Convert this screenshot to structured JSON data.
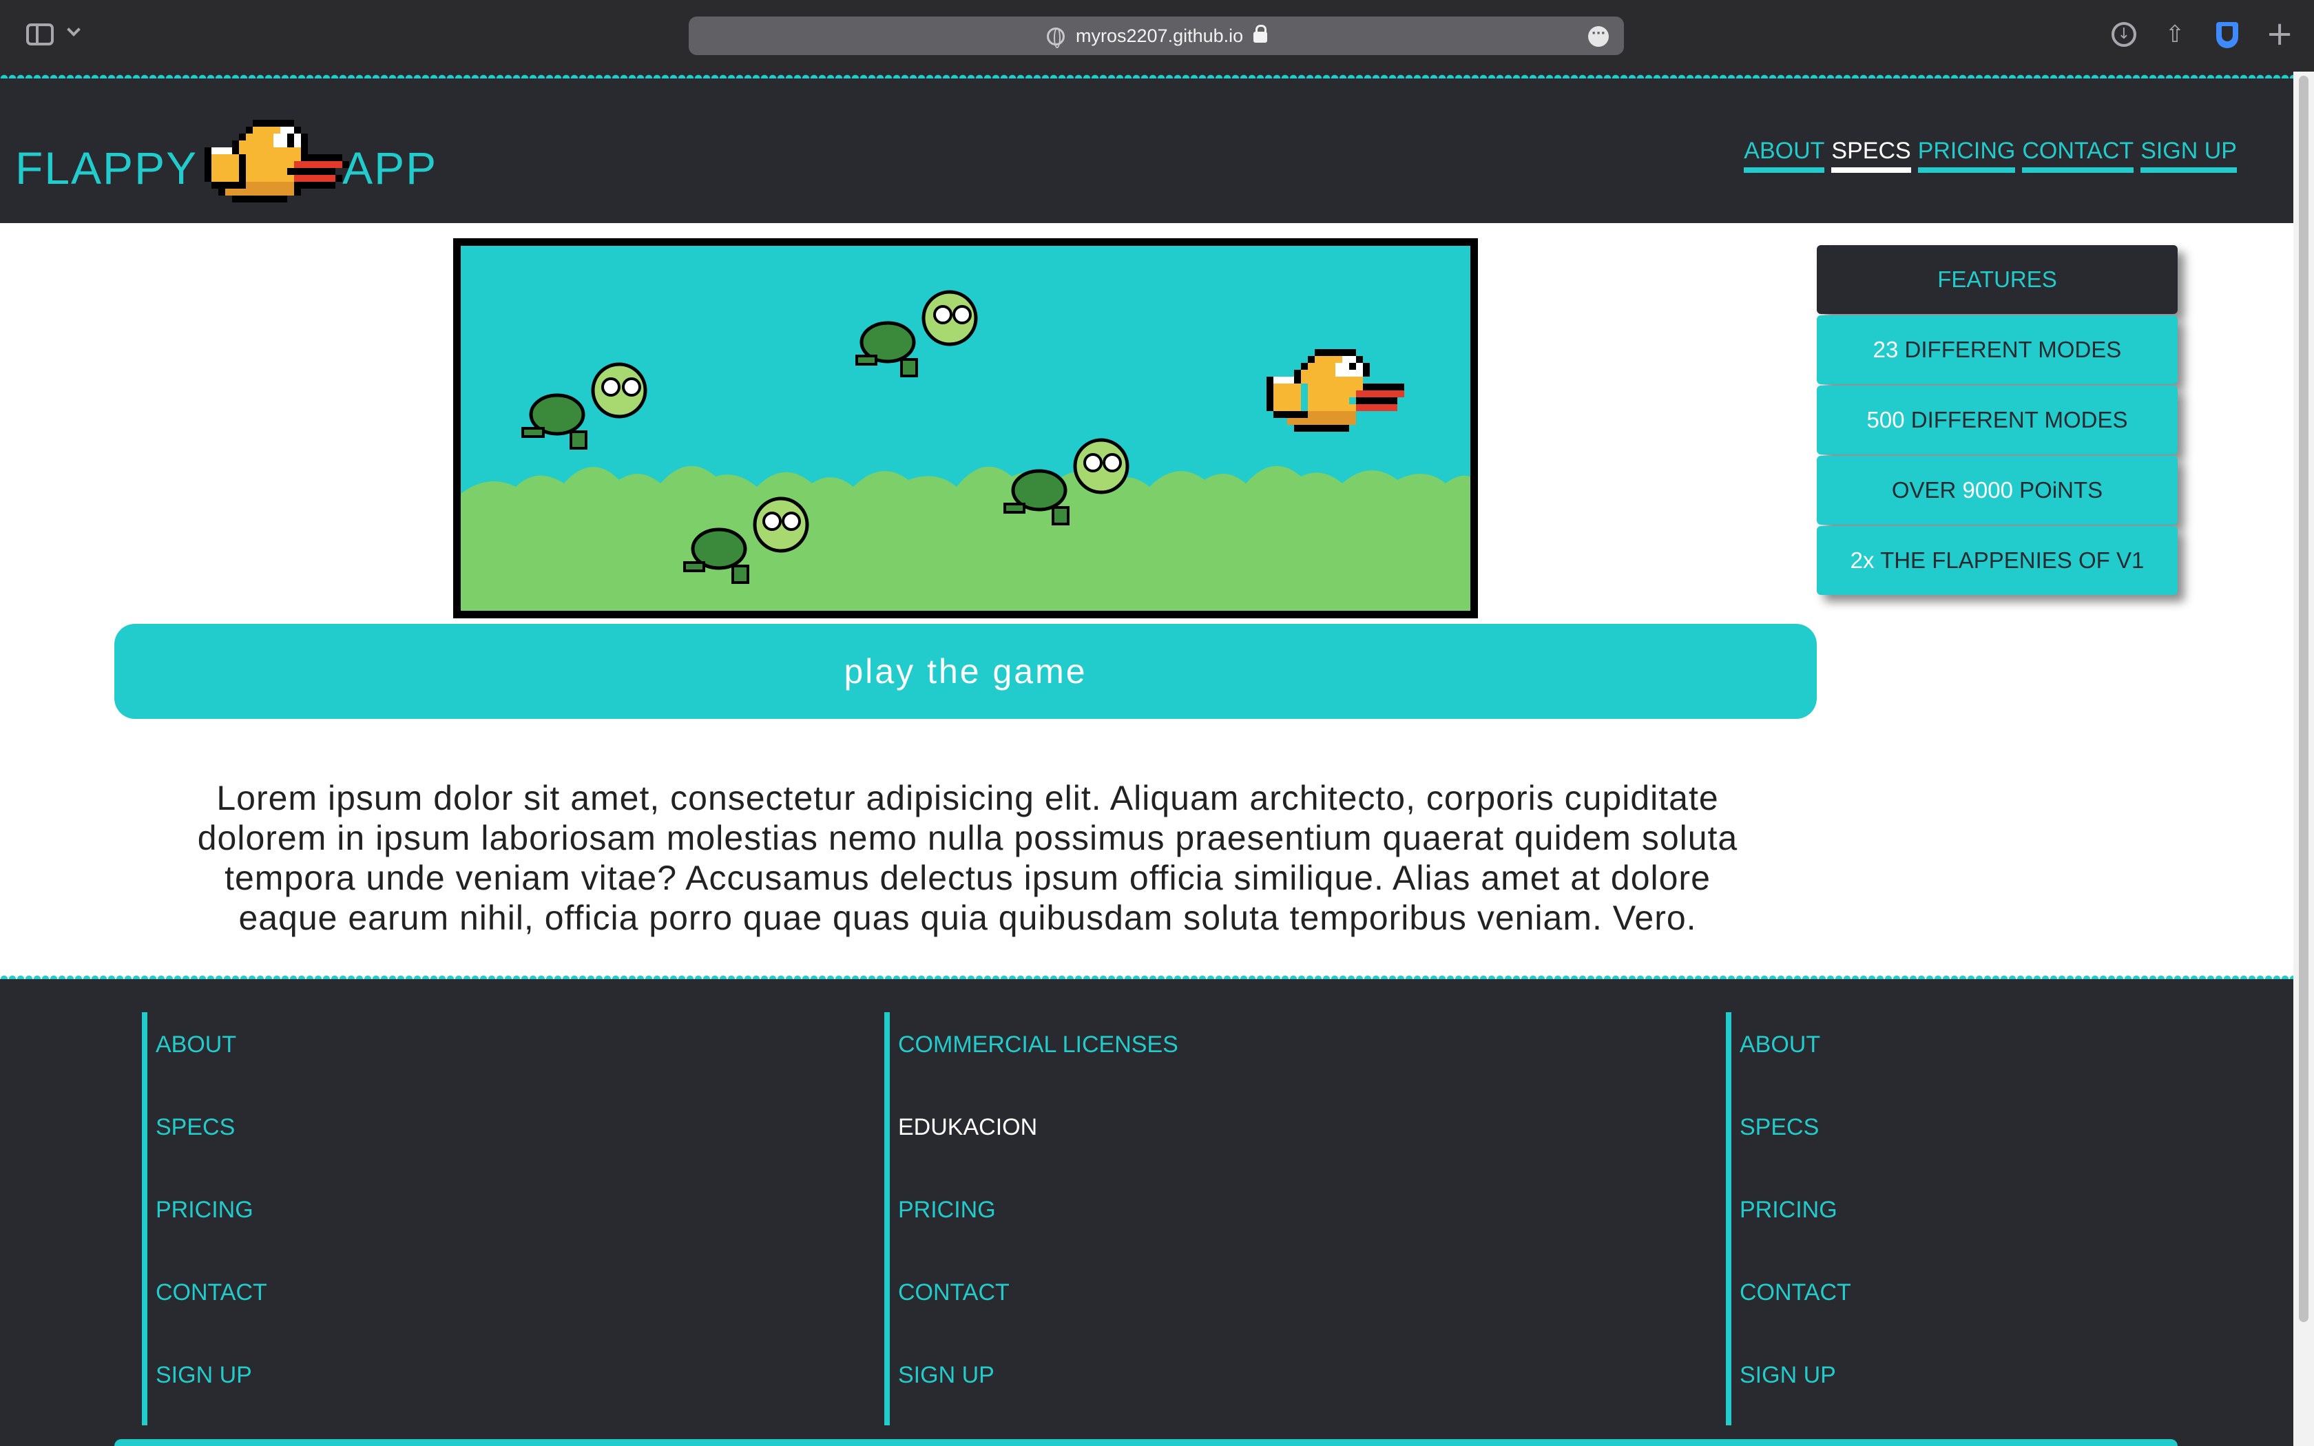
{
  "browser": {
    "url": "myros2207.github.io"
  },
  "header": {
    "logo_left": "FLAPPY",
    "logo_right": "APP",
    "nav": [
      {
        "label": "ABOUT",
        "active": false
      },
      {
        "label": "SPECS",
        "active": true
      },
      {
        "label": "PRICING",
        "active": false
      },
      {
        "label": "CONTACT",
        "active": false
      },
      {
        "label": "SIGN UP",
        "active": false
      }
    ]
  },
  "main": {
    "play_label": "play the game",
    "description": "Lorem ipsum dolor sit amet, consectetur adipisicing elit. Aliquam architecto, corporis cupiditate dolorem in ipsum laboriosam molestias nemo nulla possimus praesentium quaerat quidem soluta tempora unde veniam vitae? Accusamus delectus ipsum officia similique. Alias amet at dolore eaque earum nihil, officia porro quae quas quia quibusdam soluta temporibus veniam. Vero."
  },
  "features": {
    "title": "FEATURES",
    "items": [
      {
        "hl": "23",
        "text": " DIFFERENT MODES"
      },
      {
        "hl": "500",
        "text": " DIFFERENT MODES"
      },
      {
        "pre": "OVER ",
        "hl": "9000",
        "text": " POiNTS"
      },
      {
        "hl": "2x",
        "text": " THE FLAPPENIES OF V1"
      }
    ]
  },
  "footer": {
    "col1": [
      "ABOUT",
      "SPECS",
      "PRICING",
      "CONTACT",
      "SIGN UP"
    ],
    "col2": [
      "COMMERCIAL LICENSES",
      "EDUKACION",
      "PRICING",
      "CONTACT",
      "SIGN UP"
    ],
    "col3": [
      "ABOUT",
      "SPECS",
      "PRICING",
      "CONTACT",
      "SIGN UP"
    ]
  },
  "colors": {
    "accent": "#22cccc",
    "dark": "#282a2f",
    "white": "#ffffff"
  }
}
